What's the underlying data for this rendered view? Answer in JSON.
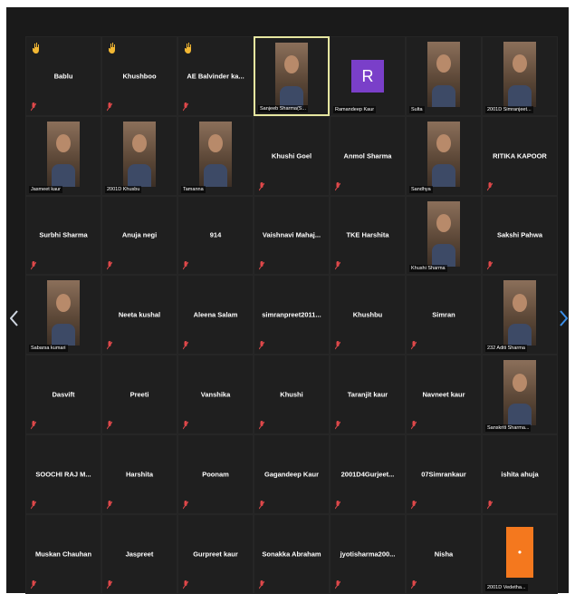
{
  "colors": {
    "background": "#1a1a1a",
    "tile": "#1f1f1f",
    "text": "#ffffff",
    "muted_mic": "#e0484a",
    "raised_hand": "#f2b733",
    "active_border": "#e6e6a0",
    "avatar_purple": "#7a3fc9",
    "avatar_orange": "#f4781e"
  },
  "navigation": {
    "prev_icon": "chevron-left-icon",
    "next_icon": "chevron-right-icon"
  },
  "participants": [
    {
      "name": "Bablu",
      "video": false,
      "hand": true
    },
    {
      "name": "Khushboo",
      "video": false,
      "hand": true
    },
    {
      "name": "AE Balvinder ka...",
      "video": false,
      "hand": true
    },
    {
      "name": "Sanjeeb Sharma(S...",
      "video": true,
      "active": true
    },
    {
      "name": "Ramandeep Kaur",
      "avatar": "R",
      "avatar_color": "purple"
    },
    {
      "name": "Sulta",
      "video": true
    },
    {
      "name": "2001D Simranjeet...",
      "video": true
    },
    {
      "name": "Jasmeet kaur",
      "video": true
    },
    {
      "name": "2001D Khusbu",
      "video": true
    },
    {
      "name": "Tamanna",
      "video": true
    },
    {
      "name": "Khushi Goel",
      "video": false
    },
    {
      "name": "Anmol Sharma",
      "video": false
    },
    {
      "name": "Sandhya",
      "video": true
    },
    {
      "name": "RITIKA KAPOOR",
      "video": false
    },
    {
      "name": "Surbhi Sharma",
      "video": false
    },
    {
      "name": "Anuja negi",
      "video": false
    },
    {
      "name": "914",
      "video": false
    },
    {
      "name": "Vaishnavi Mahaj...",
      "video": false
    },
    {
      "name": "TKE Harshita",
      "video": false
    },
    {
      "name": "Khushi Sharma",
      "video": true
    },
    {
      "name": "Sakshi Pahwa",
      "video": false
    },
    {
      "name": "Sabarsa kumari",
      "video": true
    },
    {
      "name": "Neeta kushal",
      "video": false
    },
    {
      "name": "Aleena Salam",
      "video": false
    },
    {
      "name": "simranpreet2011...",
      "video": false
    },
    {
      "name": "Khushbu",
      "video": false
    },
    {
      "name": "Simran",
      "video": false
    },
    {
      "name": "232 Aditi Sharma",
      "video": true
    },
    {
      "name": "Dasvift",
      "video": false
    },
    {
      "name": "Preeti",
      "video": false
    },
    {
      "name": "Vanshika",
      "video": false
    },
    {
      "name": "Khushi",
      "video": false
    },
    {
      "name": "Taranjit kaur",
      "video": false
    },
    {
      "name": "Navneet kaur",
      "video": false
    },
    {
      "name": "Sanskriti Sharma...",
      "video": true
    },
    {
      "name": "SOOCHI RAJ M...",
      "video": false
    },
    {
      "name": "Harshita",
      "video": false
    },
    {
      "name": "Poonam",
      "video": false
    },
    {
      "name": "Gagandeep Kaur",
      "video": false
    },
    {
      "name": "2001D4Gurjeet...",
      "video": false
    },
    {
      "name": "07Simrankaur",
      "video": false
    },
    {
      "name": "ishita ahuja",
      "video": false
    },
    {
      "name": "Muskan Chauhan",
      "video": false
    },
    {
      "name": "Jaspreet",
      "video": false
    },
    {
      "name": "Gurpreet kaur",
      "video": false
    },
    {
      "name": "Sonakka Abraham",
      "video": false
    },
    {
      "name": "jyotisharma200...",
      "video": false
    },
    {
      "name": "Nisha",
      "video": false
    },
    {
      "name": "2001D Vedetha...",
      "avatar": "•",
      "avatar_color": "orange"
    }
  ]
}
